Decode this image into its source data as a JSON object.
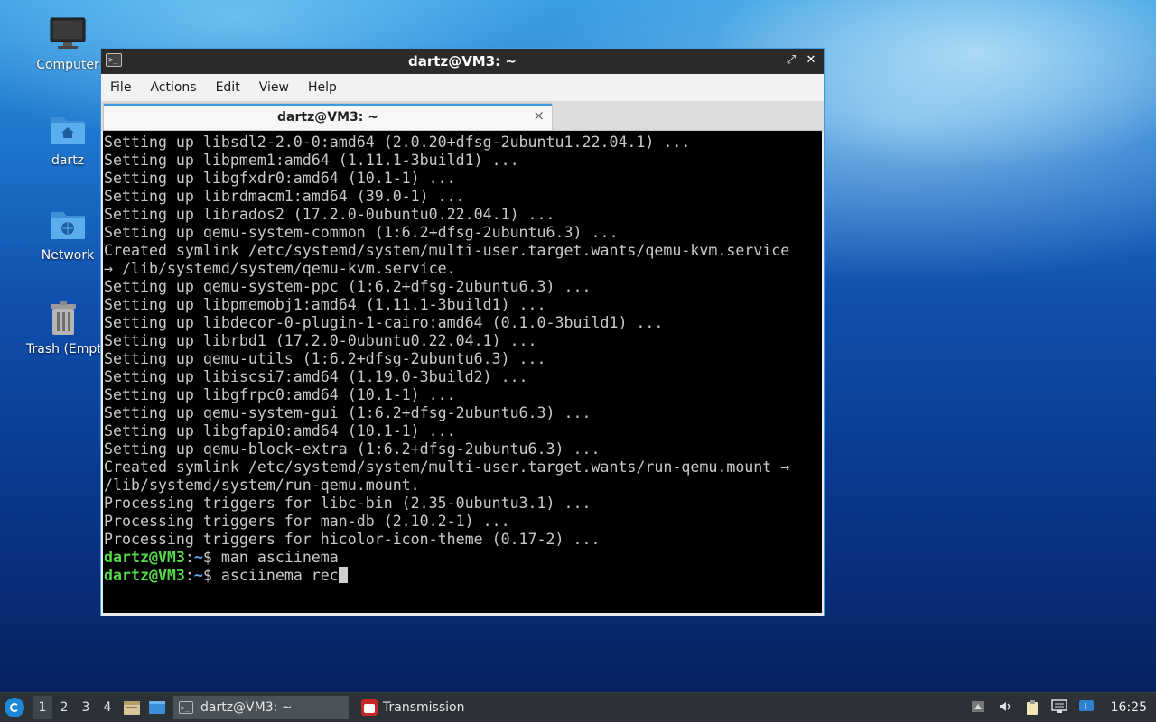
{
  "desktop": {
    "icons": [
      {
        "label": "Computer",
        "icon": "computer-icon"
      },
      {
        "label": "dartz",
        "icon": "home-folder-icon"
      },
      {
        "label": "Network",
        "icon": "network-folder-icon"
      },
      {
        "label": "Trash (Empty)",
        "icon": "trash-icon"
      }
    ]
  },
  "window": {
    "title": "dartz@VM3: ~",
    "menu": [
      "File",
      "Actions",
      "Edit",
      "View",
      "Help"
    ],
    "tab_label": "dartz@VM3: ~",
    "tab_close": "×",
    "controls": {
      "minimize": "–",
      "maximize": "⤢",
      "close": "✕"
    }
  },
  "terminal": {
    "lines": [
      "Setting up libsdl2-2.0-0:amd64 (2.0.20+dfsg-2ubuntu1.22.04.1) ...",
      "Setting up libpmem1:amd64 (1.11.1-3build1) ...",
      "Setting up libgfxdr0:amd64 (10.1-1) ...",
      "Setting up librdmacm1:amd64 (39.0-1) ...",
      "Setting up librados2 (17.2.0-0ubuntu0.22.04.1) ...",
      "Setting up qemu-system-common (1:6.2+dfsg-2ubuntu6.3) ...",
      "Created symlink /etc/systemd/system/multi-user.target.wants/qemu-kvm.service",
      "→ /lib/systemd/system/qemu-kvm.service.",
      "Setting up qemu-system-ppc (1:6.2+dfsg-2ubuntu6.3) ...",
      "Setting up libpmemobj1:amd64 (1.11.1-3build1) ...",
      "Setting up libdecor-0-plugin-1-cairo:amd64 (0.1.0-3build1) ...",
      "Setting up librbd1 (17.2.0-0ubuntu0.22.04.1) ...",
      "Setting up qemu-utils (1:6.2+dfsg-2ubuntu6.3) ...",
      "Setting up libiscsi7:amd64 (1.19.0-3build2) ...",
      "Setting up libgfrpc0:amd64 (10.1-1) ...",
      "Setting up qemu-system-gui (1:6.2+dfsg-2ubuntu6.3) ...",
      "Setting up libgfapi0:amd64 (10.1-1) ...",
      "Setting up qemu-block-extra (1:6.2+dfsg-2ubuntu6.3) ...",
      "Created symlink /etc/systemd/system/multi-user.target.wants/run-qemu.mount →",
      "/lib/systemd/system/run-qemu.mount.",
      "Processing triggers for libc-bin (2.35-0ubuntu3.1) ...",
      "Processing triggers for man-db (2.10.2-1) ...",
      "Processing triggers for hicolor-icon-theme (0.17-2) ..."
    ],
    "prompt_user": "dartz@VM3",
    "prompt_sep": ":",
    "prompt_path": "~",
    "prompt_dollar": "$ ",
    "commands": [
      "man asciinema",
      "asciinema rec"
    ]
  },
  "taskbar": {
    "workspaces": [
      "1",
      "2",
      "3",
      "4"
    ],
    "active_workspace": "1",
    "tasks": [
      {
        "label": "dartz@VM3: ~",
        "icon": "terminal-icon",
        "active": true
      },
      {
        "label": "Transmission",
        "icon": "transmission-icon",
        "active": false
      }
    ],
    "tray": [
      "keyboard-layout-icon",
      "volume-icon",
      "clipboard-icon",
      "network-icon",
      "update-notifier-icon"
    ],
    "clock": "16:25"
  },
  "colors": {
    "accent": "#3c9be0",
    "prompt_user": "#56d84b",
    "prompt_path": "#5aa9f2",
    "terminal_bg": "#000000",
    "terminal_fg": "#c9c9c9"
  }
}
